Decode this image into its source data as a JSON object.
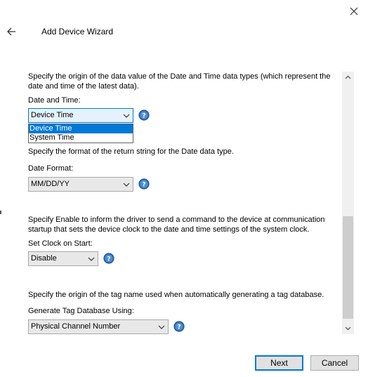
{
  "header": {
    "title": "Add Device Wizard",
    "back_icon": "arrow-left-icon",
    "close_icon": "close-icon"
  },
  "sections": {
    "datetime": {
      "description": "Specify the origin of the data value of the Date and Time data types (which represent the date and time of the latest data).",
      "label": "Date and Time:",
      "value": "Device Time",
      "options": [
        "Device Time",
        "System Time"
      ]
    },
    "date_format": {
      "description": "Specify the format of the return string for the Date data type.",
      "label": "Date Format:",
      "value": "MM/DD/YY"
    },
    "set_clock": {
      "description": "Specify Enable to inform the driver to send a command to the device at communication startup that sets the device clock to the date and time settings of the system clock.",
      "label": "Set Clock on Start:",
      "value": "Disable"
    },
    "tag_db": {
      "description": "Specify the origin of the tag name used when automatically generating a tag database.",
      "label": "Generate Tag Database Using:",
      "value": "Physical Channel Number"
    }
  },
  "footer": {
    "next_label": "Next",
    "cancel_label": "Cancel"
  },
  "colors": {
    "accent": "#0078d7",
    "help_icon": "#2c6bb3"
  }
}
